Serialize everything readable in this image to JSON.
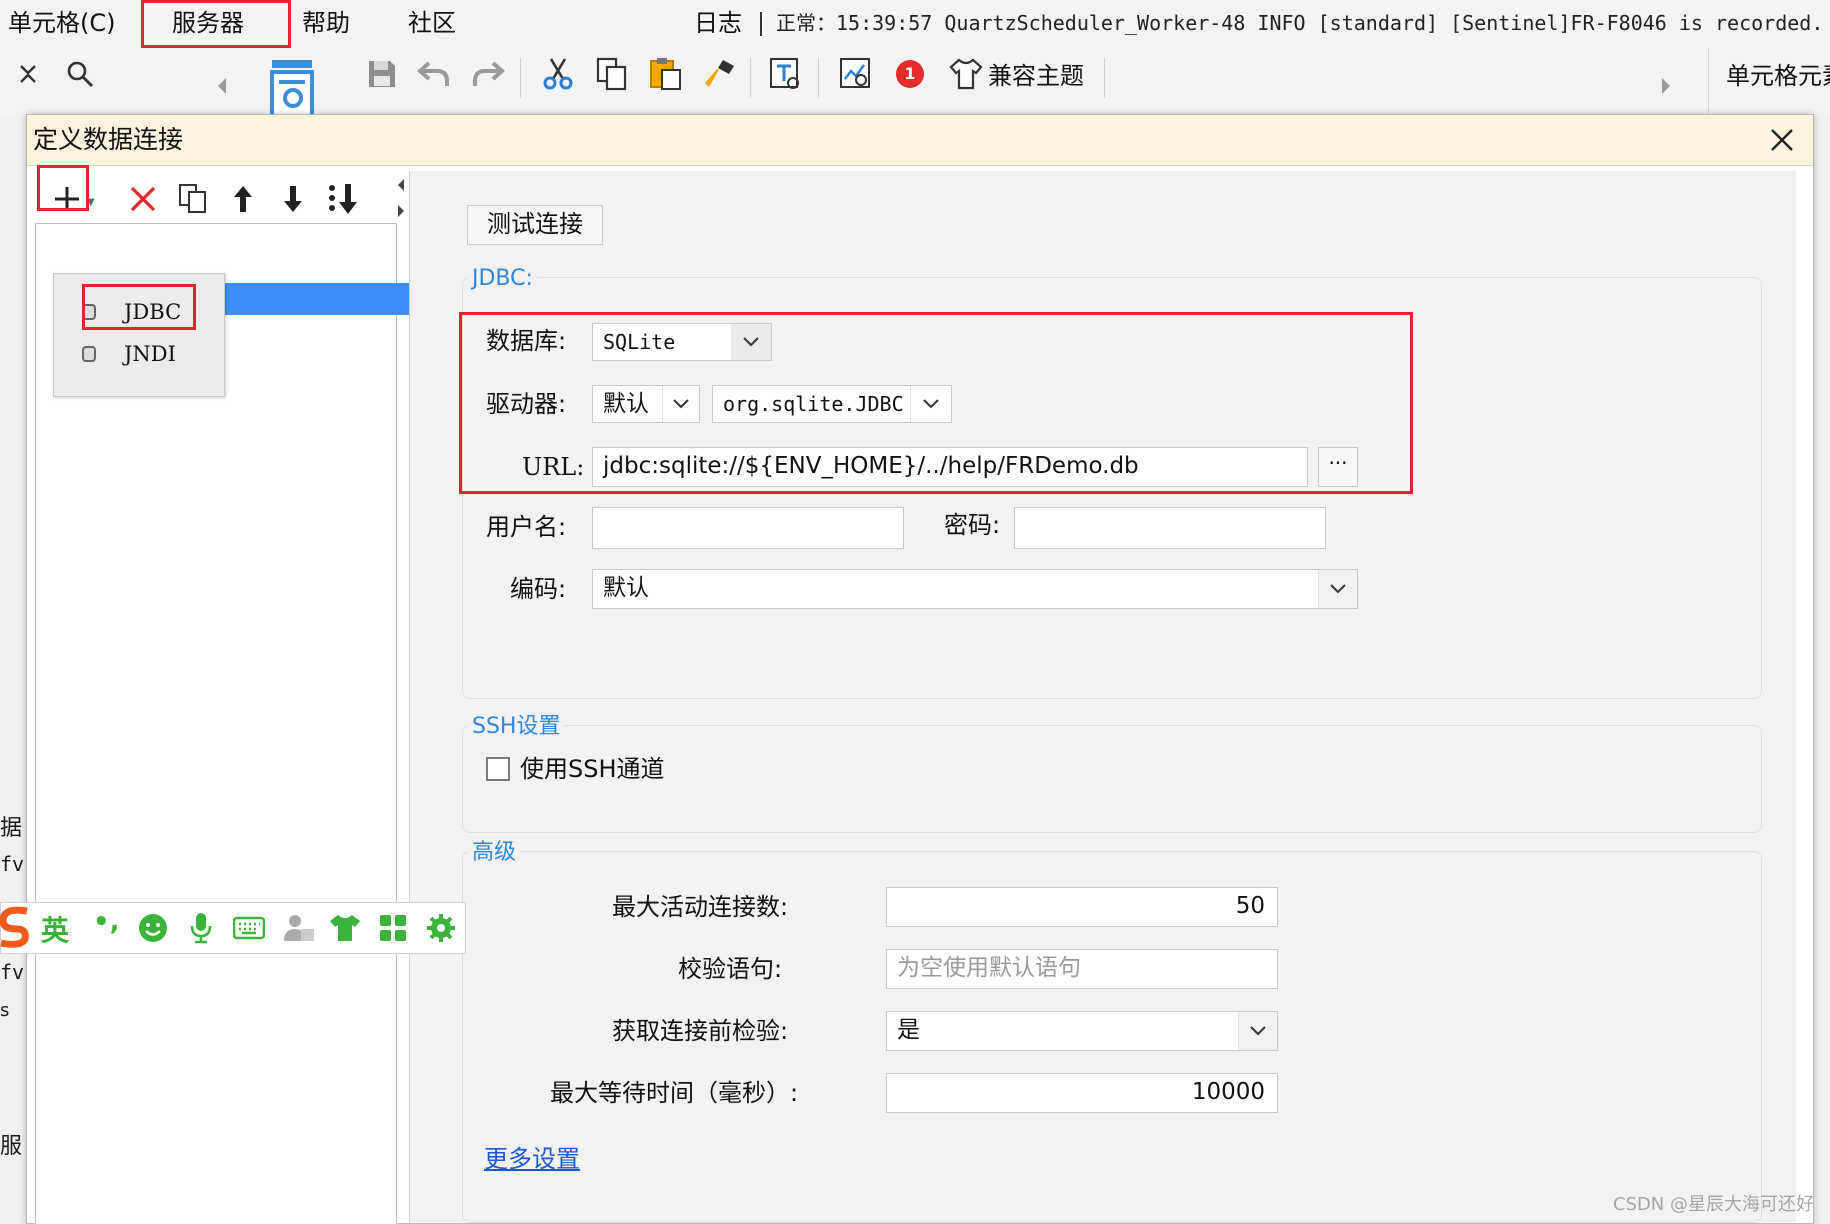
{
  "menubar": {
    "items": [
      "单元格(C)",
      "服务器",
      "帮助",
      "社区"
    ],
    "log_label": "日志",
    "status": "正常：15:39:57 QuartzScheduler_Worker-48 INFO [standard] [Sentinel]FR-F8046 is recorded."
  },
  "toolbar": {
    "compat_theme": "兼容主题",
    "right_label": "单元格元素",
    "alert_badge": "1"
  },
  "dialog": {
    "title": "定义数据连接",
    "add_menu": [
      "JDBC",
      "JNDI"
    ],
    "test_button": "测试连接",
    "jdbc": {
      "section_title": "JDBC:",
      "database_label": "数据库:",
      "database_value": "SQLite",
      "driver_label": "驱动器:",
      "driver_mode": "默认",
      "driver_class": "org.sqlite.JDBC",
      "url_label": "URL:",
      "url_value": "jdbc:sqlite://${ENV_HOME}/../help/FRDemo.db",
      "url_more": "···",
      "username_label": "用户名:",
      "username_value": "",
      "password_label": "密码:",
      "password_value": "",
      "encoding_label": "编码:",
      "encoding_value": "默认"
    },
    "ssh": {
      "section_title": "SSH设置",
      "use_ssh_label": "使用SSH通道"
    },
    "advanced": {
      "section_title": "高级",
      "max_active_label": "最大活动连接数:",
      "max_active_value": "50",
      "validation_label": "校验语句:",
      "validation_placeholder": "为空使用默认语句",
      "test_before_label": "获取连接前检验:",
      "test_before_value": "是",
      "max_wait_label": "最大等待时间（毫秒）:",
      "max_wait_value": "10000",
      "more_settings": "更多设置"
    }
  },
  "ime": {
    "lang": "英",
    "punct": "•,"
  },
  "side_fragments": [
    "据",
    "fv",
    "fv",
    "s",
    "服"
  ],
  "watermark": "CSDN @星辰大海可还好",
  "colors": {
    "highlight_red": "#e0262c",
    "selection_blue": "#3d8ff5",
    "section_blue": "#2e88d6",
    "link_blue": "#1b59d4",
    "title_bar": "#fbf3de",
    "ime_green": "#3bb33b"
  }
}
